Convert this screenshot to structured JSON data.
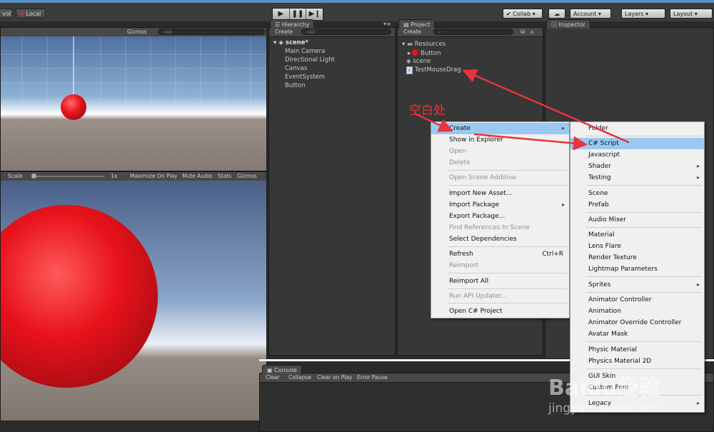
{
  "toolbar": {
    "pivot": "vot",
    "local": "Local",
    "collab": "Collab ▾",
    "account": "Account",
    "layers": "Layers",
    "layout": "Layout"
  },
  "scene_view": {
    "gizmos": "Gizmos",
    "search_placeholder": "All"
  },
  "game_view": {
    "scale_label": "Scale",
    "scale_value": "1x",
    "maximize": "Maximize On Play",
    "mute": "Mute Audio",
    "stats": "Stats",
    "gizmos": "Gizmos"
  },
  "hierarchy": {
    "tab": "Hierarchy",
    "create": "Create",
    "search_placeholder": "All",
    "scene_name": "scene*",
    "items": [
      "Main Camera",
      "Directional Light",
      "Canvas",
      "EventSystem",
      "Button"
    ]
  },
  "project": {
    "tab": "Project",
    "create": "Create",
    "folder": "Resources",
    "items": [
      "Button",
      "scene",
      "TestMouseDrag"
    ]
  },
  "inspector": {
    "tab": "Inspector"
  },
  "console": {
    "tab": "Console",
    "buttons": [
      "Clear",
      "Collapse",
      "Clear on Play",
      "Error Pause"
    ]
  },
  "annotation": {
    "text": "空白处"
  },
  "context_menu": {
    "items": [
      {
        "label": "Create",
        "state": "highlighted",
        "submenu": true
      },
      {
        "label": "Show in Explorer"
      },
      {
        "label": "Open",
        "state": "disabled"
      },
      {
        "label": "Delete",
        "state": "disabled"
      },
      {
        "label": "Open Scene Additive",
        "state": "disabled"
      },
      {
        "label": "Import New Asset..."
      },
      {
        "label": "Import Package",
        "submenu": true
      },
      {
        "label": "Export Package..."
      },
      {
        "label": "Find References In Scene",
        "state": "disabled"
      },
      {
        "label": "Select Dependencies"
      },
      {
        "label": "Refresh",
        "shortcut": "Ctrl+R"
      },
      {
        "label": "Reimport",
        "state": "disabled"
      },
      {
        "label": "Reimport All"
      },
      {
        "label": "Run API Updater...",
        "state": "disabled"
      },
      {
        "label": "Open C# Project"
      }
    ]
  },
  "create_submenu": {
    "items": [
      {
        "label": "Folder"
      },
      {
        "label": "C# Script",
        "state": "highlighted"
      },
      {
        "label": "Javascript"
      },
      {
        "label": "Shader",
        "submenu": true
      },
      {
        "label": "Testing",
        "submenu": true
      },
      {
        "label": "Scene"
      },
      {
        "label": "Prefab"
      },
      {
        "label": "Audio Mixer"
      },
      {
        "label": "Material"
      },
      {
        "label": "Lens Flare"
      },
      {
        "label": "Render Texture"
      },
      {
        "label": "Lightmap Parameters"
      },
      {
        "label": "Sprites",
        "submenu": true
      },
      {
        "label": "Animator Controller"
      },
      {
        "label": "Animation"
      },
      {
        "label": "Animator Override Controller"
      },
      {
        "label": "Avatar Mask"
      },
      {
        "label": "Physic Material"
      },
      {
        "label": "Physics Material 2D"
      },
      {
        "label": "GUI Skin"
      },
      {
        "label": "Custom Font"
      },
      {
        "label": "Legacy",
        "submenu": true
      }
    ]
  },
  "watermark": {
    "brand": "Baidu经验",
    "url": "jingyan.baidu.com"
  },
  "colors": {
    "highlight": "#99c9f3",
    "annotation": "#e8343a",
    "sphere": "#e8121b"
  }
}
